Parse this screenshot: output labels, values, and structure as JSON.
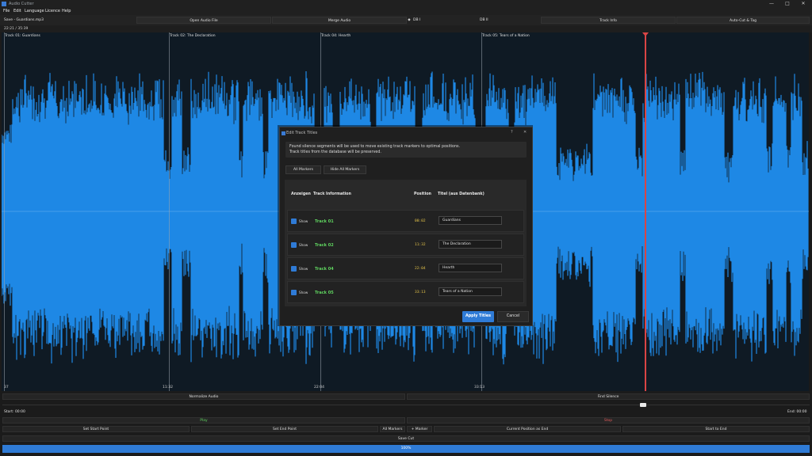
{
  "window": {
    "title": "Audio Cutter"
  },
  "menu": [
    "File",
    "Edit",
    "Language",
    "Licence",
    "Help"
  ],
  "toolbar": {
    "file_label": "Save - Guardians.mp3",
    "open_label": "Open Audio File",
    "merge_label": "Merge Audio",
    "mark_symbol": "◆",
    "db1_label": "DB I",
    "db2_label": "DB II",
    "trackinfo_label": "Track Info",
    "autocut_label": "Auto-Cut & Tag"
  },
  "timebar": {
    "time": "22:21 / 35:39"
  },
  "colors": {
    "waveform": "#1e88e5",
    "playhead": "#d94545",
    "accent": "#2f7bd6",
    "track_name": "#5fd35f",
    "position": "#e5c44a"
  },
  "markers": [
    {
      "label": "Track 01: Guardians",
      "time": "37"
    },
    {
      "label": "Track 02: The Declaration",
      "time": "11:32"
    },
    {
      "label": "Track 04: Hearth",
      "time": "22:04"
    },
    {
      "label": "Track 05: Tears of a Nation",
      "time": "33:13"
    }
  ],
  "controls": {
    "normalize": "Normalize Audio",
    "find_silence": "Find Silence",
    "start": "Start: 00:00",
    "end": "End: 00:00",
    "play": "Play",
    "stop": "Stop",
    "set_start": "Set Start Point",
    "set_end": "Set End Point",
    "all_markers": "All Markers",
    "plus_marker": "+ Marker",
    "current_end": "Current Position as End",
    "start_end": "Start to End",
    "save_cut": "Save Cut",
    "progress_text": "100%",
    "progress": 1.0
  },
  "dialog": {
    "title": "Edit Track Titles",
    "help": "?",
    "close": "✕",
    "info_line1": "Found silence segments will be used to move existing track markers to optimal positions.",
    "info_line2": "Track titles from the database will be preserved.",
    "all_markers": "All Markers",
    "hide_markers": "Hide All Markers",
    "headers": {
      "show": "Anzeigen",
      "info": "Track Information",
      "position": "Position",
      "title": "Titel (aus Datenbank)"
    },
    "rows": [
      {
        "show": "Show",
        "name": "Track 01",
        "position": "00:02",
        "title": "Guardians"
      },
      {
        "show": "Show",
        "name": "Track 02",
        "position": "11:32",
        "title": "The Declaration"
      },
      {
        "show": "Show",
        "name": "Track 04",
        "position": "22:04",
        "title": "Hearth"
      },
      {
        "show": "Show",
        "name": "Track 05",
        "position": "33:13",
        "title": "Tears of a Nation"
      }
    ],
    "apply": "Apply Titles",
    "cancel": "Cancel"
  }
}
